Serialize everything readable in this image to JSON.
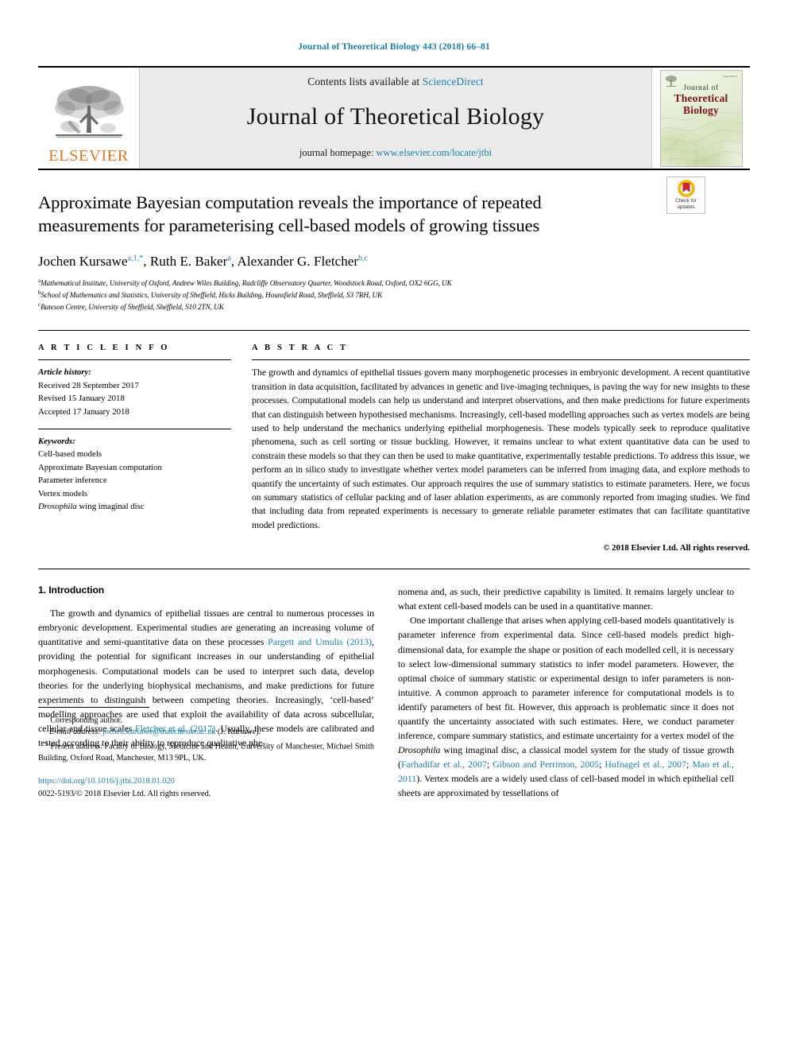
{
  "running_head": "Journal of Theoretical Biology 443 (2018) 66–81",
  "masthead": {
    "publisher_name": "ELSEVIER",
    "contents_prefix": "Contents lists available at ",
    "contents_link": "ScienceDirect",
    "journal_title": "Journal of Theoretical Biology",
    "homepage_prefix": "journal homepage: ",
    "homepage_url": "www.elsevier.com/locate/jtbi",
    "cover": {
      "line1": "Journal of",
      "line2": "Theoretical",
      "line3": "Biology",
      "corner_note": "ScienceDirect"
    }
  },
  "article": {
    "title": "Approximate Bayesian computation reveals the importance of repeated measurements for parameterising cell-based models of growing tissues",
    "crossmark": {
      "line1": "Check for",
      "line2": "updates"
    },
    "authors_html": "Jochen Kursawe<sup>a,1,</sup><sup class=\"star\">*</sup>, Ruth E. Baker<sup>a</sup>, Alexander G. Fletcher<sup>b,c</sup>",
    "affiliations": [
      {
        "marker": "a",
        "text": "Mathematical Institute, University of Oxford, Andrew Wiles Building, Radcliffe Observatory Quarter, Woodstock Road, Oxford, OX2 6GG, UK"
      },
      {
        "marker": "b",
        "text": "School of Mathematics and Statistics, University of Sheffield, Hicks Building, Hounsfield Road, Sheffield, S3 7RH, UK"
      },
      {
        "marker": "c",
        "text": "Bateson Centre, University of Sheffield, Sheffield, S10 2TN, UK"
      }
    ]
  },
  "article_info": {
    "heading": "A R T I C L E   I N F O",
    "history_label": "Article history:",
    "history": [
      "Received 28 September 2017",
      "Revised 15 January 2018",
      "Accepted 17 January 2018"
    ],
    "keywords_label": "Keywords:",
    "keywords": [
      "Cell-based models",
      "Approximate Bayesian computation",
      "Parameter inference",
      "Vertex models",
      "Drosophila wing imaginal disc"
    ],
    "keyword_italic_prefix": "Drosophila",
    "keyword_italic_rest": " wing imaginal disc"
  },
  "abstract": {
    "heading": "A B S T R A C T",
    "text": "The growth and dynamics of epithelial tissues govern many morphogenetic processes in embryonic development. A recent quantitative transition in data acquisition, facilitated by advances in genetic and live-imaging techniques, is paving the way for new insights to these processes. Computational models can help us understand and interpret observations, and then make predictions for future experiments that can distinguish between hypothesised mechanisms. Increasingly, cell-based modelling approaches such as vertex models are being used to help understand the mechanics underlying epithelial morphogenesis. These models typically seek to reproduce qualitative phenomena, such as cell sorting or tissue buckling. However, it remains unclear to what extent quantitative data can be used to constrain these models so that they can then be used to make quantitative, experimentally testable predictions. To address this issue, we perform an in silico study to investigate whether vertex model parameters can be inferred from imaging data, and explore methods to quantify the uncertainty of such estimates. Our approach requires the use of summary statistics to estimate parameters. Here, we focus on summary statistics of cellular packing and of laser ablation experiments, as are commonly reported from imaging studies. We find that including data from repeated experiments is necessary to generate reliable parameter estimates that can facilitate quantitative model predictions.",
    "copyright": "© 2018 Elsevier Ltd. All rights reserved."
  },
  "body": {
    "section_number_title": "1. Introduction",
    "left_paragraph_html": "The growth and dynamics of epithelial tissues are central to numerous processes in embryonic development. Experimental studies are generating an increasing volume of quantitative and semi-quantitative data on these processes <span class=\"lnk\">Pargett and Umulis (2013)</span>, providing the potential for significant increases in our understanding of epithelial morphogenesis. Computational models can be used to interpret such data, develop theories for the underlying biophysical mechanisms, and make predictions for future experiments to distinguish between competing theories. Increasingly, &lsquo;cell-based&rsquo; modelling approaches are used that exploit the availability of data across subcellular, cellular and tissue scales <span class=\"lnk\">Fletcher et al. (2017)</span>. Usually, these models are calibrated and tested according to their ability to reproduce qualitative phe-",
    "right_paragraph_1_html": "nomena and, as such, their predictive capability is limited. It remains largely unclear to what extent cell-based models can be used in a quantitative manner.",
    "right_paragraph_2_html": "One important challenge that arises when applying cell-based models quantitatively is parameter inference from experimental data. Since cell-based models predict high-dimensional data, for example the shape or position of each modelled cell, it is necessary to select low-dimensional summary statistics to infer model parameters. However, the optimal choice of summary statistic or experimental design to infer parameters is non-intuitive. A common approach to parameter inference for computational models is to identify parameters of best fit. However, this approach is problematic since it does not quantify the uncertainty associated with such estimates. Here, we conduct parameter inference, compare summary statistics, and estimate uncertainty for a vertex model of the <i>Drosophila</i> wing imaginal disc, a classical model system for the study of tissue growth (<span class=\"lnk\">Farhadifar et al., 2007</span>; <span class=\"lnk\">Gibson and Perrimon, 2005</span>; <span class=\"lnk\">Hufnagel et al., 2007</span>; <span class=\"lnk\">Mao et al., 2011</span>). Vertex models are a widely used class of cell-based model in which epithelial cell sheets are approximated by tessellations of"
  },
  "footnotes": {
    "corresponding_marker": "*",
    "corresponding_text": "Corresponding author.",
    "email_label": "E-mail address:",
    "email": "jochen.kursawe@manchester.ac.uk",
    "email_suffix": "(J. Kursawe).",
    "present_marker": "1",
    "present_address": "Present address: Faculty of Biology, Medicine and Health, University of Manchester, Michael Smith Building, Oxford Road, Manchester, M13 9PL, UK.",
    "doi": "https://doi.org/10.1016/j.jtbi.2018.01.020",
    "issn_line": "0022-5193/© 2018 Elsevier Ltd. All rights reserved."
  },
  "colors": {
    "link": "#1a7fa8",
    "elsevier_orange": "#E87722",
    "masthead_bg": "#ebebeb"
  }
}
